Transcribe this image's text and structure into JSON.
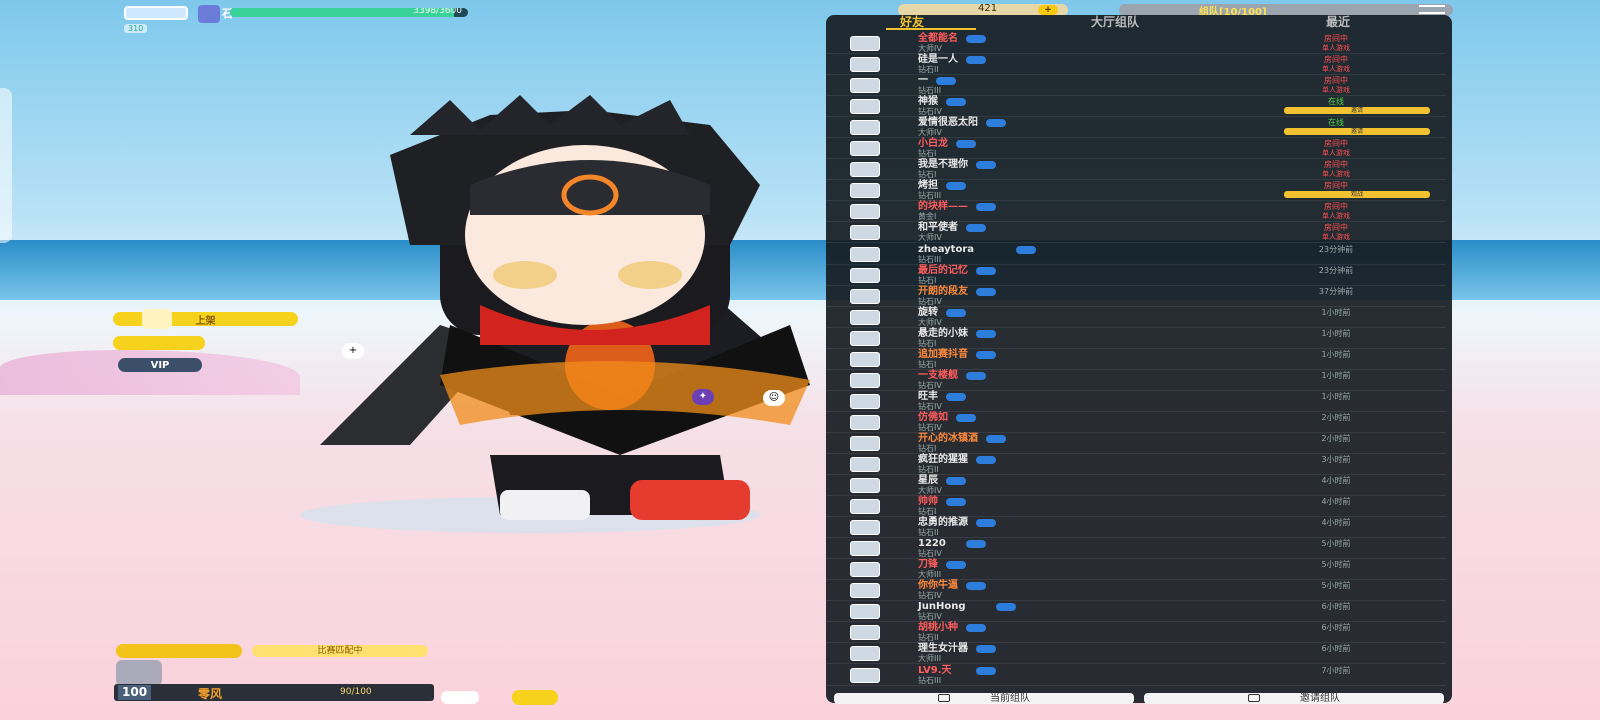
{
  "player": {
    "name": "石II",
    "exp": "3398/3600",
    "exp_fraction": 0.94,
    "level_tag": "310",
    "level": "100",
    "nickname": "零风",
    "coins": "90/100"
  },
  "left_buttons": {
    "b1": "上架",
    "b2": "",
    "b3": "VIP"
  },
  "bottom": {
    "status": "比赛匹配中",
    "b1": "",
    "b2": ""
  },
  "top": {
    "coin_count": "421",
    "coin_plus": "+",
    "team": "组队[10/100]"
  },
  "tabs": [
    {
      "label": "好友",
      "active": true
    },
    {
      "label": "大厅组队",
      "active": false
    },
    {
      "label": "最近",
      "active": false
    }
  ],
  "friends": [
    {
      "name": "全都能名",
      "sub": "大师IV",
      "color": "red",
      "status": "房间中",
      "status2": "单人游戏",
      "busy": true
    },
    {
      "name": "硅是一人",
      "sub": "钻石II",
      "color": "",
      "status": "房间中",
      "status2": "单人游戏",
      "busy": true
    },
    {
      "name": "一",
      "sub": "钻石III",
      "color": "",
      "status": "房间中",
      "status2": "单人游戏",
      "busy": true
    },
    {
      "name": "神猴",
      "sub": "钻石IV",
      "color": "",
      "status": "在线",
      "status2": "",
      "busy": false,
      "green": true,
      "join": "邀请"
    },
    {
      "name": "爱情很恶太阳",
      "sub": "大师IV",
      "color": "",
      "status": "在线",
      "status2": "",
      "busy": false,
      "green": true,
      "join": "邀请"
    },
    {
      "name": "小白龙",
      "sub": "钻石I",
      "color": "red",
      "status": "房间中",
      "status2": "单人游戏",
      "busy": true
    },
    {
      "name": "我是不理你",
      "sub": "钻石I",
      "color": "",
      "status": "房间中",
      "status2": "单人游戏",
      "busy": true
    },
    {
      "name": "烤担",
      "sub": "钻石III",
      "color": "",
      "status": "房间中",
      "status2": "",
      "busy": true,
      "join": "观战"
    },
    {
      "name": "的块样——",
      "sub": "黄金I",
      "color": "red",
      "status": "房间中",
      "status2": "单人游戏",
      "busy": true
    },
    {
      "name": "和平使者",
      "sub": "大师IV",
      "color": "",
      "status": "房间中",
      "status2": "单人游戏",
      "busy": true
    },
    {
      "name": "zheaytora",
      "sub": "钻石III",
      "color": "",
      "status": "23分钟前",
      "status2": "",
      "busy": false
    },
    {
      "name": "最后的记忆",
      "sub": "钻石I",
      "color": "red",
      "status": "23分钟前",
      "status2": "",
      "busy": false
    },
    {
      "name": "开朗的段友",
      "sub": "钻石IV",
      "color": "orange",
      "status": "37分钟前",
      "status2": "",
      "busy": false
    },
    {
      "name": "旋转",
      "sub": "大师IV",
      "color": "",
      "status": "1小时前",
      "status2": "",
      "busy": false
    },
    {
      "name": "悬走的小妹",
      "sub": "钻石I",
      "color": "",
      "status": "1小时前",
      "status2": "",
      "busy": false
    },
    {
      "name": "追加赛抖音",
      "sub": "钻石I",
      "color": "orange",
      "status": "1小时前",
      "status2": "",
      "busy": false
    },
    {
      "name": "一支楼舰",
      "sub": "钻石IV",
      "color": "red",
      "status": "1小时前",
      "status2": "",
      "busy": false
    },
    {
      "name": "旺丰",
      "sub": "钻石IV",
      "color": "",
      "status": "1小时前",
      "status2": "",
      "busy": false
    },
    {
      "name": "仿佛如",
      "sub": "钻石IV",
      "color": "red",
      "status": "2小时前",
      "status2": "",
      "busy": false
    },
    {
      "name": "开心的冰镇酒",
      "sub": "钻石I",
      "color": "orange",
      "status": "2小时前",
      "status2": "",
      "busy": false
    },
    {
      "name": "疯狂的猩猩",
      "sub": "钻石II",
      "color": "",
      "status": "3小时前",
      "status2": "",
      "busy": false
    },
    {
      "name": "星辰",
      "sub": "大师IV",
      "color": "",
      "status": "4小时前",
      "status2": "",
      "busy": false
    },
    {
      "name": "帅帅",
      "sub": "钻石I",
      "color": "red",
      "status": "4小时前",
      "status2": "",
      "busy": false
    },
    {
      "name": "忠勇的推源",
      "sub": "钻石II",
      "color": "",
      "status": "4小时前",
      "status2": "",
      "busy": false
    },
    {
      "name": "1220",
      "sub": "钻石IV",
      "color": "",
      "status": "5小时前",
      "status2": "",
      "busy": false
    },
    {
      "name": "刀锋",
      "sub": "大师III",
      "color": "red",
      "status": "5小时前",
      "status2": "",
      "busy": false
    },
    {
      "name": "你你牛逼",
      "sub": "钻石IV",
      "color": "orange",
      "status": "5小时前",
      "status2": "",
      "busy": false
    },
    {
      "name": "JunHong",
      "sub": "钻石IV",
      "color": "",
      "status": "6小时前",
      "status2": "",
      "busy": false
    },
    {
      "name": "胡桃小种",
      "sub": "钻石II",
      "color": "red",
      "status": "6小时前",
      "status2": "",
      "busy": false
    },
    {
      "name": "理生女汁器",
      "sub": "大师III",
      "color": "",
      "status": "6小时前",
      "status2": "",
      "busy": false
    },
    {
      "name": "LV9.天",
      "sub": "钻石III",
      "color": "red",
      "status": "7小时前",
      "status2": "",
      "busy": false
    }
  ],
  "footer": {
    "left": "当前组队",
    "right": "邀请组队"
  },
  "icons": {
    "menu": "hamburger-icon",
    "coin": "coin-icon"
  }
}
